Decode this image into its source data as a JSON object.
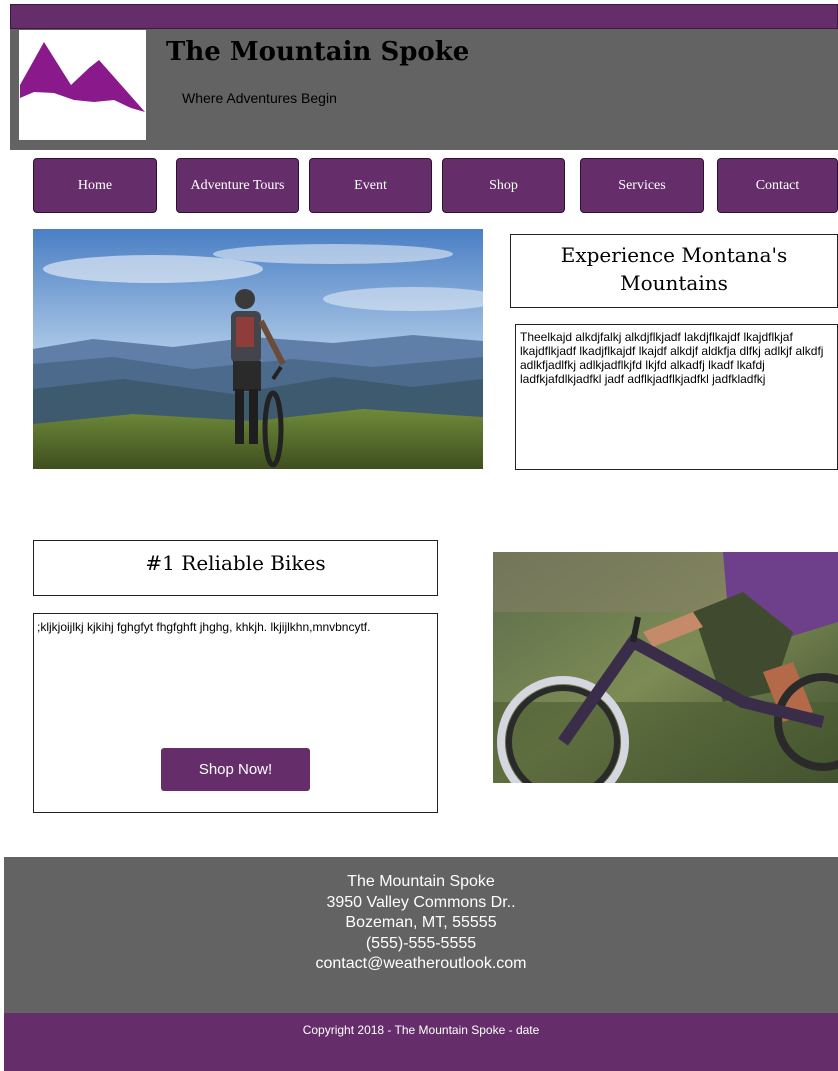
{
  "header": {
    "site_title": "The Mountain Spoke",
    "tagline": "Where Adventures Begin",
    "logo_icon": "mountain-logo-icon"
  },
  "nav": {
    "items": [
      {
        "label": "Home"
      },
      {
        "label": "Adventure Tours"
      },
      {
        "label": "Event"
      },
      {
        "label": "Shop"
      },
      {
        "label": "Services"
      },
      {
        "label": "Contact"
      }
    ]
  },
  "experience": {
    "heading": "Experience Montana's Mountains",
    "body": "Theelkajd alkdjfalkj alkdjflkjadf lakdjflkajdf lkajdflkjaf lkajdflkjadf lkadjflkajdf lkajdf alkdjf aldkfja dlfkj adlkjf alkdfj adlkfjadlfkj adlkjadflkjfd lkjfd alkadfj lkadf lkafdj ladfkjafdlkjadfkl jadf adflkjadflkjadfkl jadfkladfkj"
  },
  "bikes": {
    "heading": "#1 Reliable Bikes",
    "body": ";kljkjoijlkj kjkihj fghgfyt fhgfghft jhghg, khkjh. lkjijlkhn,mnvbncytf.",
    "button_label": "Shop Now!"
  },
  "footer": {
    "name": "The Mountain Spoke",
    "street": "3950 Valley Commons Dr..",
    "city": "Bozeman, MT, 55555",
    "phone": "(555)-555-5555",
    "email": "contact@weatheroutlook.com",
    "copyright": "Copyright 2018 - The Mountain Spoke - date"
  },
  "colors": {
    "brand_purple": "#652e6b",
    "header_gray": "#636363",
    "logo_purple": "#8a1a8c"
  }
}
